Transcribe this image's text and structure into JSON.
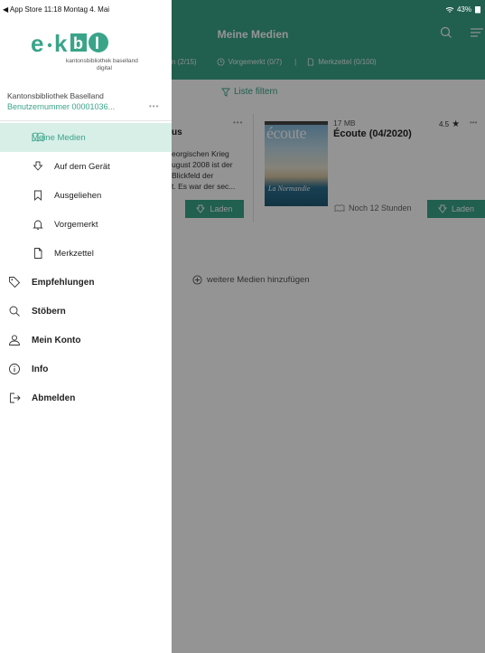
{
  "status_bar": {
    "left": "◀ App Store  11:18  Montag 4. Mai",
    "battery": "43%"
  },
  "background": {
    "title": "Meine Medien",
    "tabs": {
      "loans": "n (2/15)",
      "reserved": "Vorgemerkt (0/7)",
      "separator": "|",
      "watchlist": "Merkzettel (0/100)"
    },
    "filter_label": "Liste filtern",
    "card1": {
      "title": "us",
      "lines": [
        "eorgischen Krieg",
        "ugust 2008 ist der",
        "Blickfeld der",
        "t. Es war der sec..."
      ],
      "button": "Laden"
    },
    "card2": {
      "cover_title": "écoute",
      "cover_subtitle": "La Normandie",
      "size": "17 MB",
      "title": "Écoute (04/2020)",
      "rating": "4.5",
      "time_left": "Noch 12 Stunden",
      "button": "Laden"
    },
    "add_media": "weitere Medien hinzufügen"
  },
  "sidebar": {
    "logo_text": "e-kbl",
    "logo_sub1": "kantonsbibliothek baselland",
    "logo_sub2": "digital",
    "library_name": "Kantonsbibliothek Baselland",
    "user_number": "Benutzernummer 00001036...",
    "more": "•••",
    "items": [
      {
        "label": "Meine Medien",
        "icon": "book-open-icon",
        "active": true
      },
      {
        "label": "Auf dem Gerät",
        "icon": "download-icon"
      },
      {
        "label": "Ausgeliehen",
        "icon": "bookmark-icon"
      },
      {
        "label": "Vorgemerkt",
        "icon": "bell-icon"
      },
      {
        "label": "Merkzettel",
        "icon": "document-icon"
      },
      {
        "label": "Empfehlungen",
        "icon": "tag-icon"
      },
      {
        "label": "Stöbern",
        "icon": "search-icon"
      },
      {
        "label": "Mein Konto",
        "icon": "user-icon"
      },
      {
        "label": "Info",
        "icon": "info-icon"
      },
      {
        "label": "Abmelden",
        "icon": "logout-icon"
      }
    ]
  },
  "colors": {
    "accent": "#3aa489",
    "active_bg": "#d8efe8"
  }
}
